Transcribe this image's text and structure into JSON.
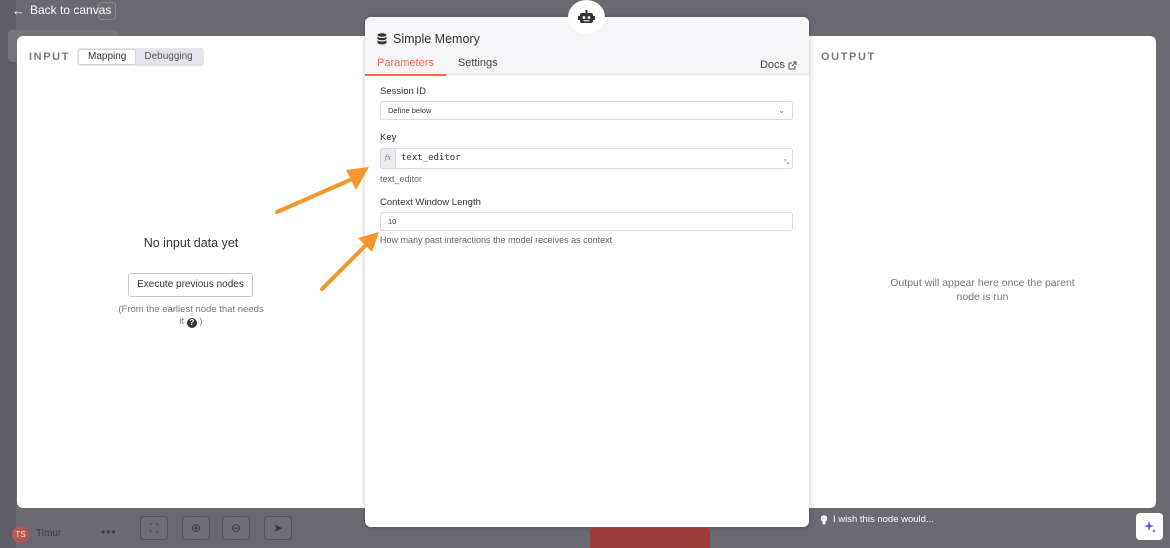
{
  "nav": {
    "back_label": "Back to canvas"
  },
  "input_pane": {
    "heading": "INPUT",
    "toggle": [
      "Mapping",
      "Debugging"
    ],
    "active_toggle": "Mapping",
    "empty_title": "No input data yet",
    "execute_label": "Execute previous nodes",
    "hint_text": "(From the earliest node that needs it ",
    "hint_close": ")",
    "help_icon": "question-circle-icon"
  },
  "node_panel": {
    "title": "Simple Memory",
    "title_icon": "database-icon",
    "header_icon": "robot-icon",
    "tabs": [
      "Parameters",
      "Settings"
    ],
    "active_tab": "Parameters",
    "docs_label": "Docs",
    "session_label": "Session ID",
    "session_value": "Define below",
    "key_label": "Key",
    "key_value": "text_editor",
    "key_hint": "text_editor",
    "context_label": "Context Window Length",
    "context_value": "10",
    "context_hint": "How many past interactions the model receives as context",
    "fx_label": "fx"
  },
  "output_pane": {
    "heading": "OUTPUT",
    "empty_message": "Output will appear here once the parent node is run"
  },
  "bottom": {
    "user_initials": "TS",
    "user_name": "Timur",
    "menu_dots": "•••",
    "feedback_label": "I wish this node would..."
  },
  "colors": {
    "accent": "#ef6c4c",
    "annotation_arrow": "#f7962b",
    "backdrop": "#6b6a72"
  }
}
